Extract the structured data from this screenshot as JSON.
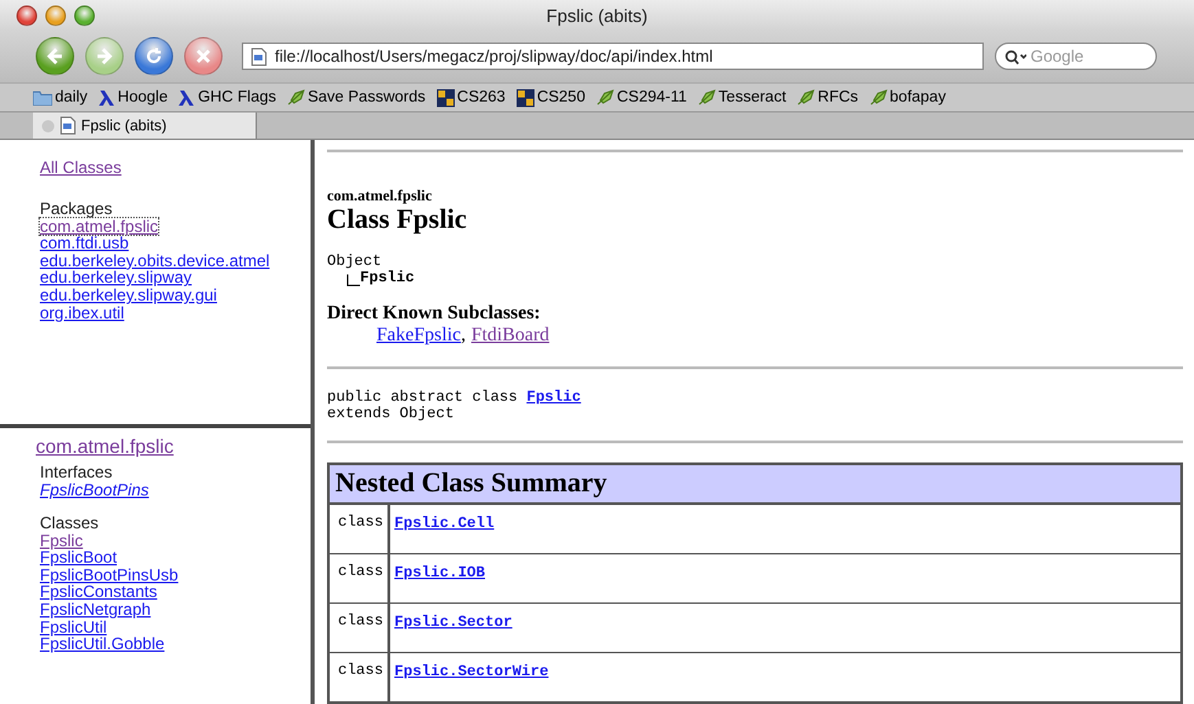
{
  "window": {
    "title": "Fpslic (abits)"
  },
  "toolbar": {
    "url": "file://localhost/Users/megacz/proj/slipway/doc/api/index.html",
    "search_placeholder": "Google"
  },
  "bookmarks": [
    {
      "label": "daily",
      "kind": "folder"
    },
    {
      "label": "Hoogle",
      "kind": "lambda"
    },
    {
      "label": "GHC Flags",
      "kind": "lambda"
    },
    {
      "label": "Save Passwords",
      "kind": "bookmarklet"
    },
    {
      "label": "CS263",
      "kind": "eecs"
    },
    {
      "label": "CS250",
      "kind": "eecs"
    },
    {
      "label": "CS294-11",
      "kind": "bookmarklet"
    },
    {
      "label": "Tesseract",
      "kind": "bookmarklet"
    },
    {
      "label": "RFCs",
      "kind": "bookmarklet"
    },
    {
      "label": "bofapay",
      "kind": "bookmarklet"
    }
  ],
  "tabs": [
    {
      "label": "Fpslic (abits)",
      "selected": true
    }
  ],
  "packages_frame": {
    "all_classes": {
      "label": "All Classes",
      "visited": true
    },
    "heading": "Packages",
    "packages": [
      {
        "label": "com.atmel.fpslic",
        "visited": true,
        "focused": true
      },
      {
        "label": "com.ftdi.usb",
        "visited": false,
        "focused": false
      },
      {
        "label": "edu.berkeley.obits.device.atmel",
        "visited": false,
        "focused": false
      },
      {
        "label": "edu.berkeley.slipway",
        "visited": false,
        "focused": false
      },
      {
        "label": "edu.berkeley.slipway.gui",
        "visited": false,
        "focused": false
      },
      {
        "label": "org.ibex.util",
        "visited": false,
        "focused": false
      }
    ]
  },
  "classes_frame": {
    "package": {
      "label": "com.atmel.fpslic",
      "visited": true
    },
    "interfaces_heading": "Interfaces",
    "interfaces": [
      {
        "label": "FpslicBootPins",
        "visited": false
      }
    ],
    "classes_heading": "Classes",
    "classes": [
      {
        "label": "Fpslic",
        "visited": true
      },
      {
        "label": "FpslicBoot",
        "visited": false
      },
      {
        "label": "FpslicBootPinsUsb",
        "visited": false
      },
      {
        "label": "FpslicConstants",
        "visited": false
      },
      {
        "label": "FpslicNetgraph",
        "visited": false
      },
      {
        "label": "FpslicUtil",
        "visited": false
      },
      {
        "label": "FpslicUtil.Gobble",
        "visited": false
      }
    ]
  },
  "main": {
    "package": "com.atmel.fpslic",
    "title": "Class Fpslic",
    "hierarchy": [
      "Object",
      "Fpslic"
    ],
    "subclasses_heading": "Direct Known Subclasses:",
    "subclasses": [
      {
        "label": "FakeFpslic",
        "visited": false
      },
      {
        "label": "FtdiBoard",
        "visited": true
      }
    ],
    "separator": ",",
    "declaration": {
      "prefix": "public abstract class",
      "name": "Fpslic",
      "extends": "extends Object"
    },
    "summary": {
      "title": "Nested Class Summary",
      "rows": [
        {
          "modifier": "class",
          "name": "Fpslic.Cell"
        },
        {
          "modifier": "class",
          "name": "Fpslic.IOB"
        },
        {
          "modifier": "class",
          "name": "Fpslic.Sector"
        },
        {
          "modifier": "class",
          "name": "Fpslic.SectorWire"
        }
      ]
    }
  }
}
